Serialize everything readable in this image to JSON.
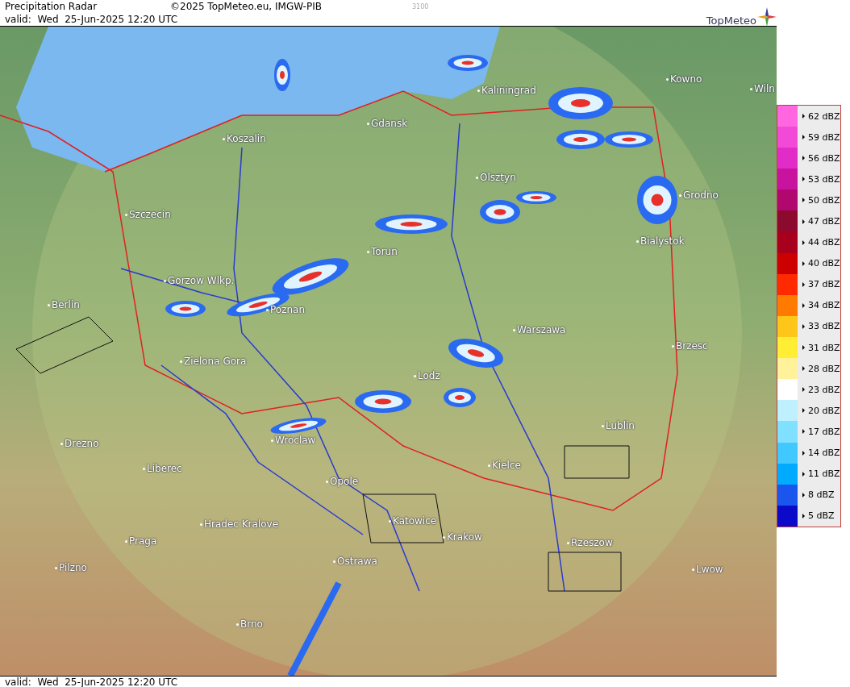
{
  "header": {
    "title": "Precipitation Radar",
    "copyright": "©2025 TopMeteo.eu, IMGW-PIB",
    "code": "3100",
    "valid": "valid:  Wed  25-Jun-2025 12:20 UTC",
    "logo": "TopMeteo"
  },
  "map": {
    "cities": [
      {
        "name": "Kaliningrad"
      },
      {
        "name": "Kowno"
      },
      {
        "name": "Wiln"
      },
      {
        "name": "Gdansk"
      },
      {
        "name": "Koszalin"
      },
      {
        "name": "Olsztyn"
      },
      {
        "name": "Grodno"
      },
      {
        "name": "Szczecin"
      },
      {
        "name": "Bialystok"
      },
      {
        "name": "Torun"
      },
      {
        "name": "Gorzow Wlkp."
      },
      {
        "name": "Berlin"
      },
      {
        "name": "Poznan"
      },
      {
        "name": "Warszawa"
      },
      {
        "name": "Brzesc"
      },
      {
        "name": "Zielona Gora"
      },
      {
        "name": "Lodz"
      },
      {
        "name": "Lublin"
      },
      {
        "name": "Wroclaw"
      },
      {
        "name": "Drezno"
      },
      {
        "name": "Liberec"
      },
      {
        "name": "Kielce"
      },
      {
        "name": "Opole"
      },
      {
        "name": "Hradec Kralove"
      },
      {
        "name": "Katowice"
      },
      {
        "name": "Krakow"
      },
      {
        "name": "Praga"
      },
      {
        "name": "Rzeszow"
      },
      {
        "name": "Pilzno"
      },
      {
        "name": "Lwow"
      },
      {
        "name": "Ostrawa"
      },
      {
        "name": "Brno"
      }
    ]
  },
  "legend": [
    {
      "label": "62 dBZ",
      "color": "#ff66e0"
    },
    {
      "label": "59 dBZ",
      "color": "#f24ad6"
    },
    {
      "label": "56 dBZ",
      "color": "#e22cc8"
    },
    {
      "label": "53 dBZ",
      "color": "#c8139f"
    },
    {
      "label": "50 dBZ",
      "color": "#b0086e"
    },
    {
      "label": "47 dBZ",
      "color": "#8c0a2d"
    },
    {
      "label": "44 dBZ",
      "color": "#a8001c"
    },
    {
      "label": "40 dBZ",
      "color": "#cc0000"
    },
    {
      "label": "37 dBZ",
      "color": "#ff2a00"
    },
    {
      "label": "34 dBZ",
      "color": "#ff7a00"
    },
    {
      "label": "33 dBZ",
      "color": "#ffc61a"
    },
    {
      "label": "31 dBZ",
      "color": "#ffee33"
    },
    {
      "label": "28 dBZ",
      "color": "#fff29a"
    },
    {
      "label": "23 dBZ",
      "color": "#ffffff"
    },
    {
      "label": "20 dBZ",
      "color": "#bff0ff"
    },
    {
      "label": "17 dBZ",
      "color": "#80e0ff"
    },
    {
      "label": "14 dBZ",
      "color": "#40c8ff"
    },
    {
      "label": "11 dBZ",
      "color": "#00aaff"
    },
    {
      "label": "8 dBZ",
      "color": "#1a55ee"
    },
    {
      "label": "5 dBZ",
      "color": "#0a0ac8"
    }
  ],
  "footer": {
    "valid": "valid:  Wed  25-Jun-2025 12:20 UTC"
  }
}
